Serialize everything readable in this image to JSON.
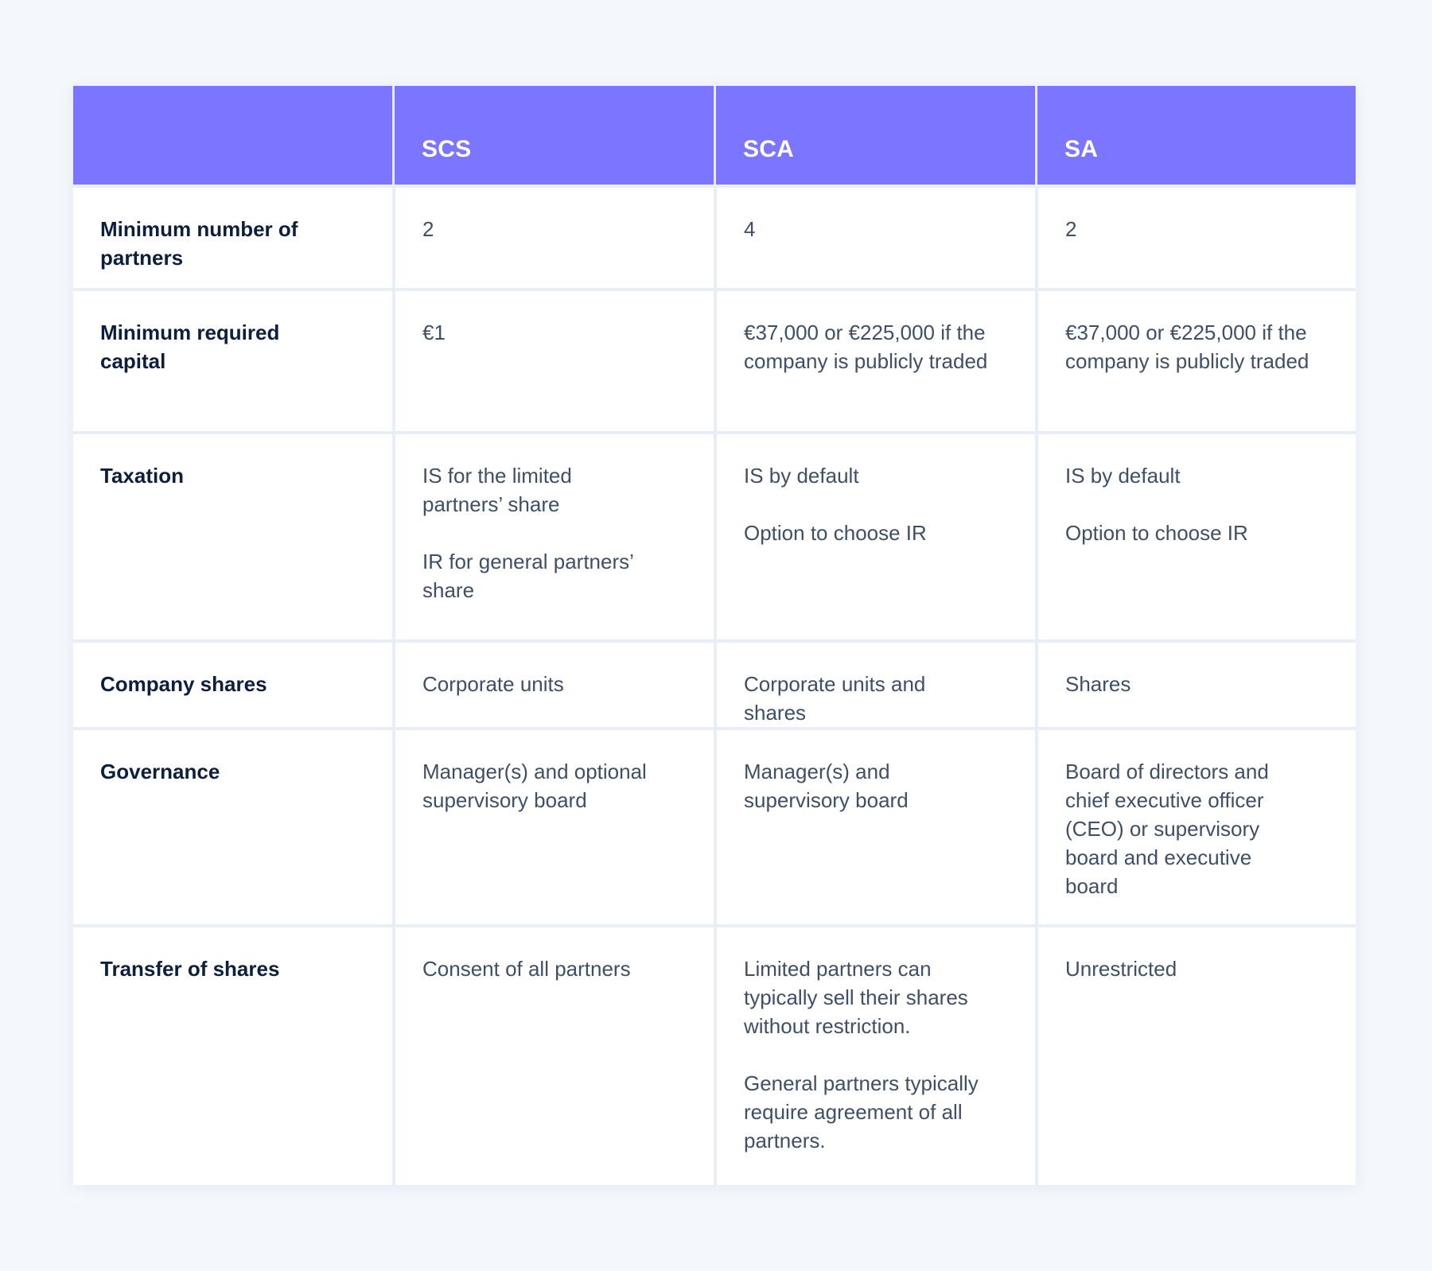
{
  "colors": {
    "header_bg": "#7b75ff",
    "header_text": "#ffffff",
    "page_bg": "#f4f7fb",
    "label_text": "#0d1f3c",
    "body_text": "#3f4f66",
    "divider": "#e8eef6"
  },
  "table": {
    "columns": [
      "",
      "SCS",
      "SCA",
      "SA"
    ],
    "rows": [
      {
        "label": "Minimum number of partners",
        "cells": [
          [
            "2"
          ],
          [
            "4"
          ],
          [
            "2"
          ]
        ]
      },
      {
        "label": "Minimum required capital",
        "cells": [
          [
            "€1"
          ],
          [
            "€37,000 or €225,000 if the company is publicly traded"
          ],
          [
            "€37,000 or €225,000 if the company is publicly traded"
          ]
        ]
      },
      {
        "label": "Taxation",
        "cells": [
          [
            "IS for the limited partners’ share",
            "IR for general partners’ share"
          ],
          [
            "IS by default",
            "Option to choose IR"
          ],
          [
            "IS by default",
            "Option to choose IR"
          ]
        ]
      },
      {
        "label": "Company shares",
        "cells": [
          [
            "Corporate units"
          ],
          [
            "Corporate units and shares"
          ],
          [
            "Shares"
          ]
        ]
      },
      {
        "label": "Governance",
        "cells": [
          [
            "Manager(s) and optional supervisory board"
          ],
          [
            "Manager(s) and supervisory board"
          ],
          [
            "Board of directors and chief executive officer (CEO) or supervisory board and executive board"
          ]
        ]
      },
      {
        "label": "Transfer of shares",
        "cells": [
          [
            "Consent of all partners"
          ],
          [
            "Limited partners can typically sell their shares without restriction.",
            "General partners typically require agreement of all partners."
          ],
          [
            "Unrestricted"
          ]
        ]
      }
    ]
  }
}
